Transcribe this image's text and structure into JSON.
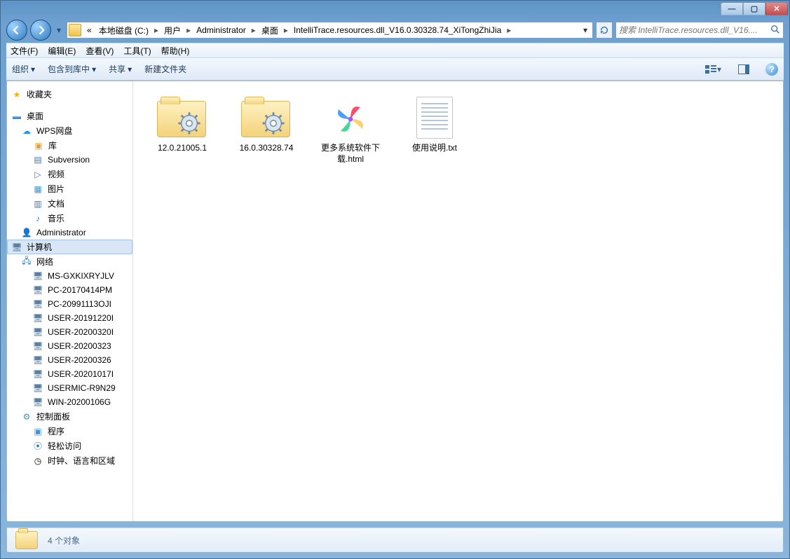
{
  "window": {
    "minimize": "—",
    "maximize": "▢",
    "close": "✕"
  },
  "breadcrumb": {
    "prefix": "«",
    "items": [
      "本地磁盘 (C:)",
      "用户",
      "Administrator",
      "桌面",
      "IntelliTrace.resources.dll_V16.0.30328.74_XiTongZhiJia"
    ]
  },
  "search": {
    "placeholder": "搜索 IntelliTrace.resources.dll_V16...."
  },
  "menubar": [
    "文件(F)",
    "编辑(E)",
    "查看(V)",
    "工具(T)",
    "帮助(H)"
  ],
  "toolbar": {
    "organize": "组织",
    "include": "包含到库中",
    "share": "共享",
    "newfolder": "新建文件夹"
  },
  "sidebar": {
    "favorites": "收藏夹",
    "desktop": "桌面",
    "wps": "WPS网盘",
    "libraries": "库",
    "lib_children": [
      {
        "icon": "svn",
        "label": "Subversion"
      },
      {
        "icon": "video",
        "label": "视频"
      },
      {
        "icon": "pic",
        "label": "图片"
      },
      {
        "icon": "doc",
        "label": "文档"
      },
      {
        "icon": "music",
        "label": "音乐"
      }
    ],
    "admin": "Administrator",
    "computer": "计算机",
    "network": "网络",
    "net_children": [
      "MS-GXKIXRYJLV",
      "PC-20170414PM",
      "PC-20991113OJI",
      "USER-20191220I",
      "USER-20200320I",
      "USER-20200323",
      "USER-20200326",
      "USER-20201017I",
      "USERMIC-R9N29",
      "WIN-20200106G"
    ],
    "control_panel": "控制面板",
    "programs": "程序",
    "ease": "轻松访问",
    "truncated": "时钟、语言和区域"
  },
  "files": [
    {
      "type": "folder-settings",
      "label": "12.0.21005.1"
    },
    {
      "type": "folder-settings",
      "label": "16.0.30328.74"
    },
    {
      "type": "pinwheel",
      "label": "更多系统软件下载.html"
    },
    {
      "type": "txt",
      "label": "使用说明.txt"
    }
  ],
  "status": {
    "count": "4 个对象"
  }
}
